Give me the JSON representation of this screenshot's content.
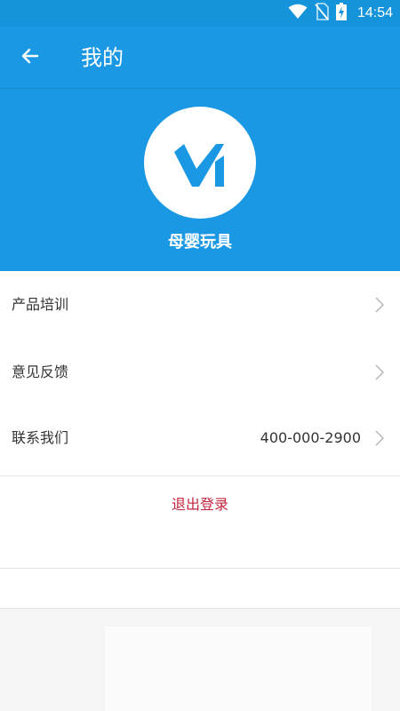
{
  "status_bar": {
    "time": "14:54",
    "icons": [
      "wifi-icon",
      "no-sim-icon",
      "battery-charging-icon"
    ]
  },
  "app_bar": {
    "title": "我的",
    "back_icon": "arrow-left-icon"
  },
  "profile": {
    "store_name": "母婴玩具",
    "logo_icon": "brand-logo"
  },
  "menu": {
    "items": [
      {
        "label": "产品培训",
        "value": "",
        "icon": "chevron-right-icon"
      },
      {
        "label": "意见反馈",
        "value": "",
        "icon": "chevron-right-icon"
      },
      {
        "label": "联系我们",
        "value": "400-000-2900",
        "icon": "chevron-right-icon"
      }
    ]
  },
  "logout": {
    "label": "退出登录"
  },
  "colors": {
    "primary_blue": "#1a98e3",
    "status_bar_blue": "#1594dc",
    "logout_red": "#c0253d",
    "text_dark": "#333333",
    "chevron_gray": "#b5b5b5"
  }
}
